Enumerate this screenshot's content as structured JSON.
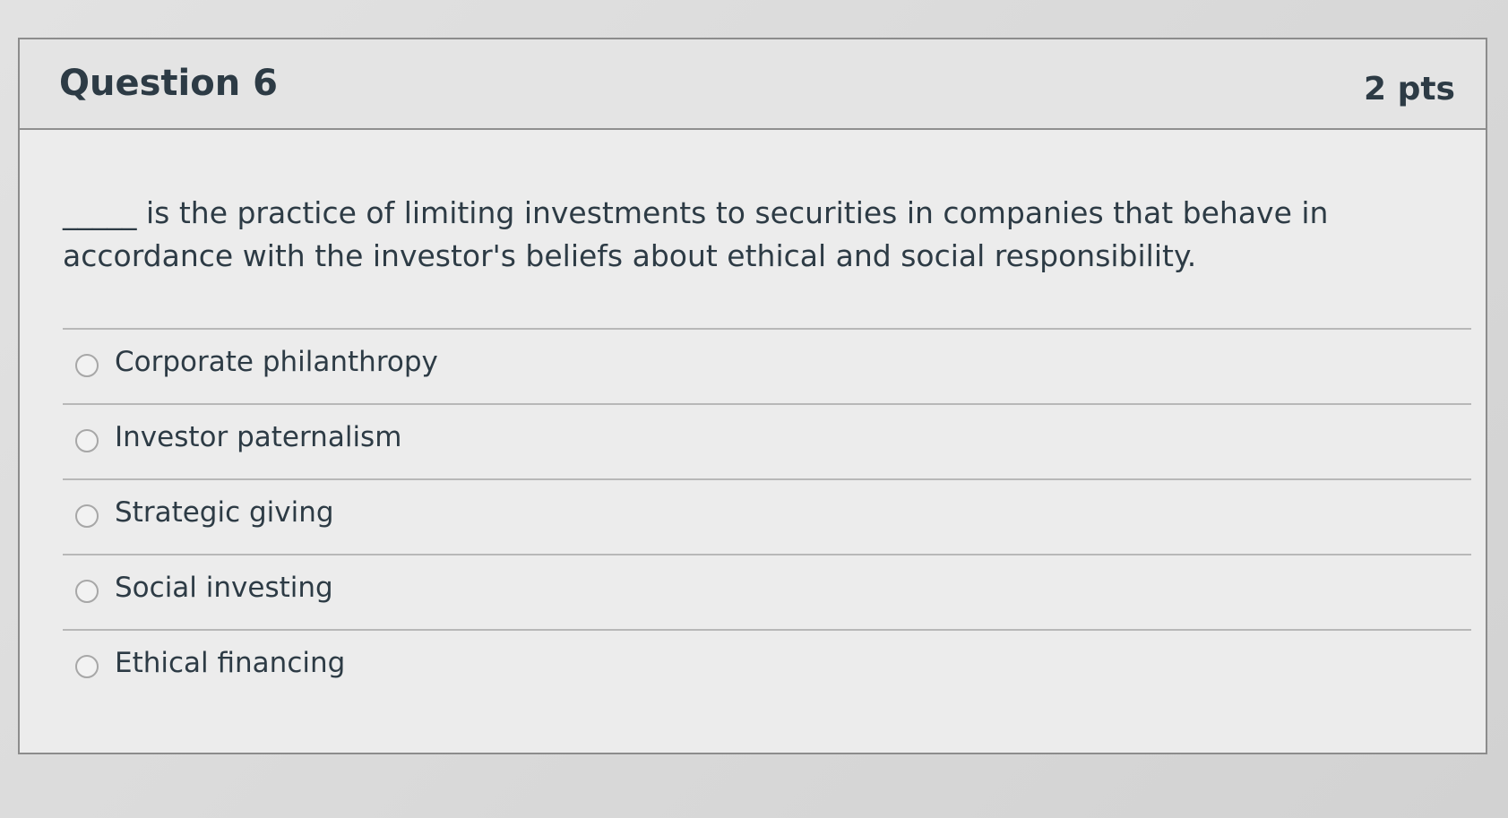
{
  "question": {
    "title": "Question 6",
    "points": "2 pts",
    "text": "_____ is the practice of limiting investments to securities in companies that behave in accordance with the investor's beliefs about ethical and social responsibility."
  },
  "answers": [
    {
      "label": "Corporate philanthropy",
      "selected": false
    },
    {
      "label": "Investor paternalism",
      "selected": false
    },
    {
      "label": "Strategic giving",
      "selected": false
    },
    {
      "label": "Social investing",
      "selected": false
    },
    {
      "label": "Ethical financing",
      "selected": false
    }
  ]
}
